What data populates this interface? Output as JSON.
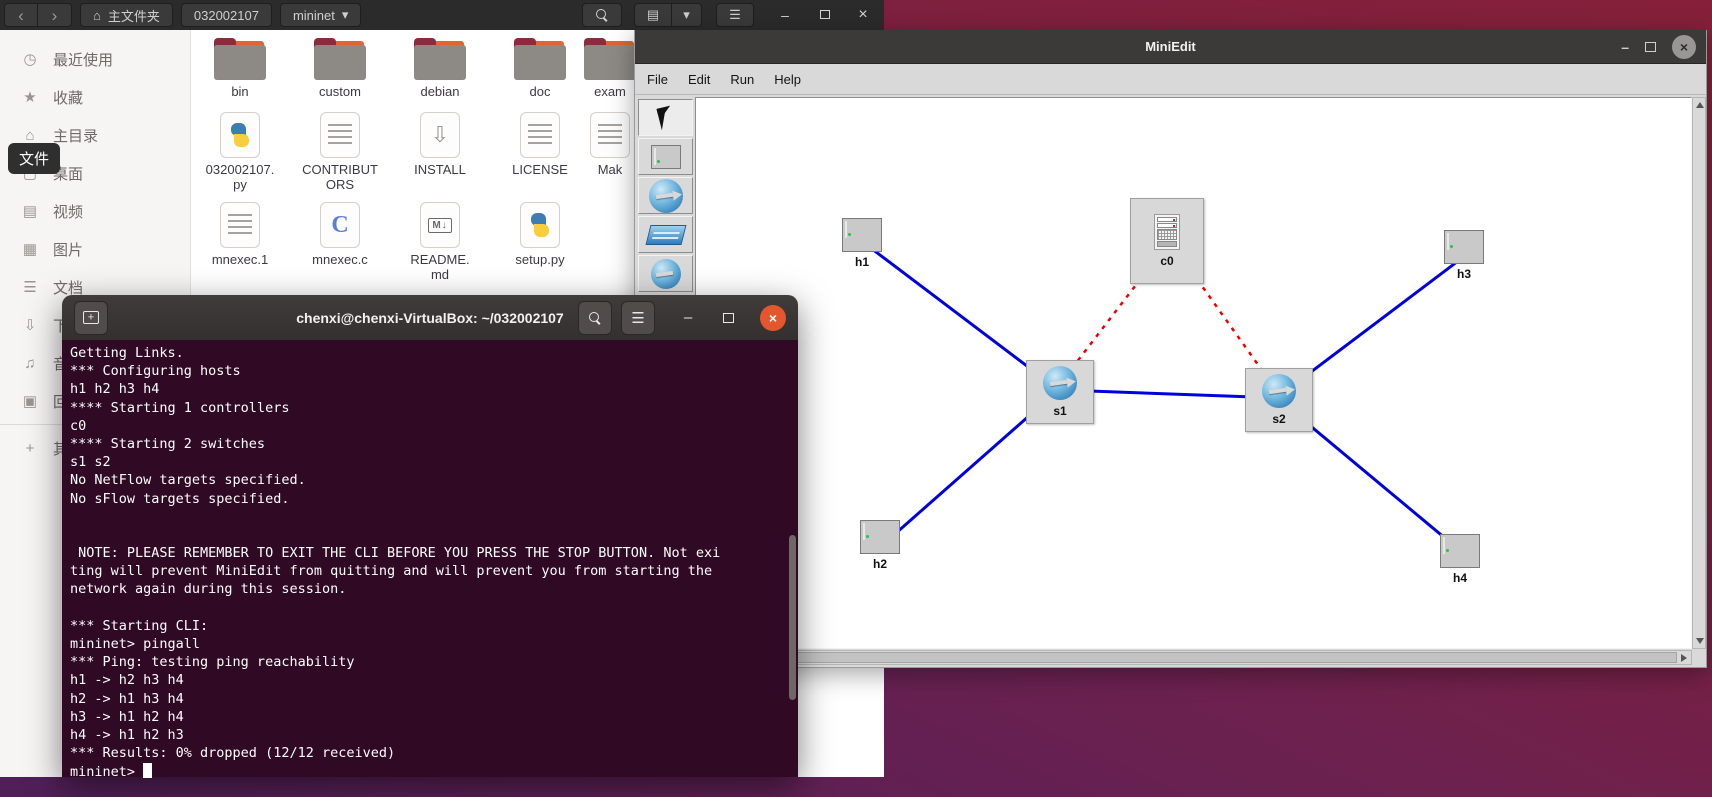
{
  "colors": {
    "ubuntu_orange": "#e4572e",
    "terminal_bg": "#300a24",
    "data_link_blue": "#0000dd",
    "control_link_red": "#ee0000",
    "titlebar_dark": "#3b3a38"
  },
  "file_manager": {
    "header": {
      "back": "‹",
      "forward": "›",
      "home_icon": "⌂",
      "path_home": "主文件夹",
      "path_current": "032002107",
      "path_dropdown": "mininet",
      "dropdown_caret": "▾",
      "view_icon": "▤",
      "view_caret": "▾",
      "menu_icon": "☰",
      "minimize": "–",
      "close": "×"
    },
    "sidebar": {
      "items": [
        {
          "icon": "◷",
          "label": "最近使用"
        },
        {
          "icon": "★",
          "label": "收藏"
        },
        {
          "icon": "⌂",
          "label": "主目录"
        },
        {
          "icon": "▢",
          "label": "桌面"
        },
        {
          "icon": "▤",
          "label": "视频"
        },
        {
          "icon": "▦",
          "label": "图片"
        },
        {
          "icon": "☰",
          "label": "文档"
        },
        {
          "icon": "⇩",
          "label": "下载"
        },
        {
          "icon": "♫",
          "label": "音乐"
        },
        {
          "icon": "▣",
          "label": "回收站"
        }
      ],
      "other_icon": "+",
      "other_label": "其他位置",
      "tooltip": "文件"
    },
    "files": {
      "row1": [
        "bin",
        "custom",
        "debian",
        "doc",
        "exam"
      ],
      "row2": [
        "032002107.\npy",
        "CONTRIBUT\nORS",
        "INSTALL",
        "LICENSE",
        "Mak"
      ],
      "row3": [
        "mnexec.1",
        "mnexec.c",
        "README.\nmd",
        "setup.py"
      ]
    }
  },
  "miniedit": {
    "title": "MiniEdit",
    "minimize": "–",
    "close": "×",
    "menu": [
      "File",
      "Edit",
      "Run",
      "Help"
    ],
    "nodes": [
      {
        "label": "h1",
        "type": "host"
      },
      {
        "label": "h2",
        "type": "host"
      },
      {
        "label": "h3",
        "type": "host"
      },
      {
        "label": "h4",
        "type": "host"
      },
      {
        "label": "s1",
        "type": "switch"
      },
      {
        "label": "s2",
        "type": "switch"
      },
      {
        "label": "c0",
        "type": "controller"
      }
    ],
    "links": [
      {
        "from": "h1",
        "to": "s1",
        "type": "data"
      },
      {
        "from": "h2",
        "to": "s1",
        "type": "data"
      },
      {
        "from": "s1",
        "to": "s2",
        "type": "data"
      },
      {
        "from": "s2",
        "to": "h3",
        "type": "data"
      },
      {
        "from": "s2",
        "to": "h4",
        "type": "data"
      },
      {
        "from": "c0",
        "to": "s1",
        "type": "control"
      },
      {
        "from": "c0",
        "to": "s2",
        "type": "control"
      }
    ]
  },
  "terminal": {
    "title": "chenxi@chenxi-VirtualBox: ~/032002107",
    "minimize": "–",
    "close": "×",
    "menu_icon": "☰",
    "lines": [
      "Getting Links.",
      "*** Configuring hosts",
      "h1 h2 h3 h4",
      "**** Starting 1 controllers",
      "c0",
      "**** Starting 2 switches",
      "s1 s2",
      "No NetFlow targets specified.",
      "No sFlow targets specified.",
      "",
      "",
      " NOTE: PLEASE REMEMBER TO EXIT THE CLI BEFORE YOU PRESS THE STOP BUTTON. Not exi",
      "ting will prevent MiniEdit from quitting and will prevent you from starting the",
      "network again during this session.",
      "",
      "*** Starting CLI:",
      "mininet> pingall",
      "*** Ping: testing ping reachability",
      "h1 -> h2 h3 h4",
      "h2 -> h1 h3 h4",
      "h3 -> h1 h2 h4",
      "h4 -> h1 h2 h3",
      "*** Results: 0% dropped (12/12 received)"
    ],
    "prompt": "mininet> "
  }
}
